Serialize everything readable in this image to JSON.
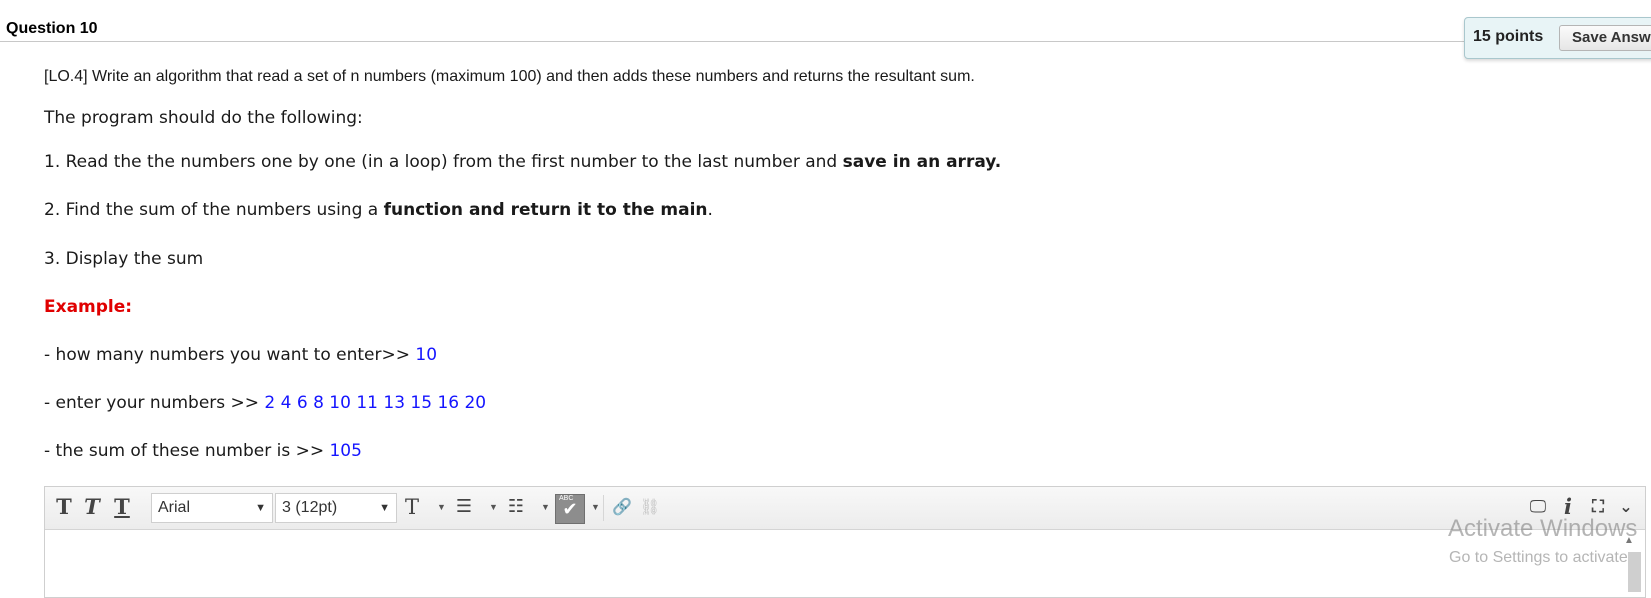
{
  "question": {
    "title": "Question 10",
    "points": "15 points",
    "save_button": "Save Answ"
  },
  "prompt": {
    "lo_line": "[LO.4] Write an algorithm that read a set of n numbers (maximum 100) and then adds these numbers and returns the resultant sum.",
    "intro": "The program should do the following:",
    "step1_prefix": "1.  Read the the numbers one by one (in a loop) from the first number to the last number and ",
    "step1_bold": "save in an array.",
    "step2_prefix": "2. Find the sum of the numbers using a ",
    "step2_bold": "function and return it to the main",
    "step2_suffix": ".",
    "step3": "3. Display the sum",
    "example_label": "Example:",
    "ex1_prefix": "- how many numbers you want to enter>> ",
    "ex1_value": "10",
    "ex2_prefix": "- enter your numbers >> ",
    "ex2_value": "2 4 6 8 10 11 13 15 16 20",
    "ex3_prefix": "- the sum of these number is >> ",
    "ex3_value": "105"
  },
  "editor": {
    "font_family": "Arial",
    "font_size": "3 (12pt)",
    "icons": [
      "bold-T-icon",
      "italic-T-icon",
      "underline-T-icon",
      "text-color-icon",
      "bullet-list-icon",
      "numbered-list-icon",
      "spellcheck-icon",
      "link-icon",
      "unlink-icon",
      "preview-icon",
      "info-icon",
      "fullscreen-icon",
      "expand-toolbar-icon"
    ]
  },
  "watermark": {
    "line1": "Activate Windows",
    "line2": "Go to Settings to activate"
  },
  "colors": {
    "example_red": "#e00000",
    "value_blue": "#1515ff",
    "points_bg": "#e8f4f6"
  }
}
